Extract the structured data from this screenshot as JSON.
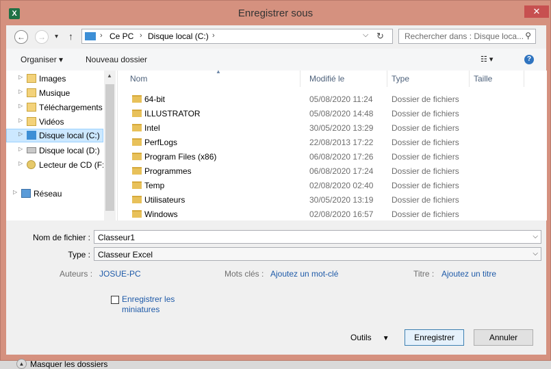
{
  "window": {
    "title": "Enregistrer sous",
    "app_icon_letter": "X",
    "close_glyph": "✕"
  },
  "nav": {
    "back_glyph": "←",
    "forward_glyph": "→",
    "recent_glyph": "▾",
    "up_glyph": "↑"
  },
  "address": {
    "crumbs": [
      "Ce PC",
      "Disque local (C:)"
    ],
    "separator": "›",
    "dropdown_glyph": "⌵",
    "refresh_glyph": "↻"
  },
  "search": {
    "placeholder": "Rechercher dans : Disque loca...",
    "icon_glyph": "⚲"
  },
  "toolbar": {
    "organize": "Organiser",
    "new_folder": "Nouveau dossier",
    "help_glyph": "?"
  },
  "sidebar": {
    "items": [
      {
        "label": "Images"
      },
      {
        "label": "Musique"
      },
      {
        "label": "Téléchargements"
      },
      {
        "label": "Vidéos"
      },
      {
        "label": "Disque local (C:)"
      },
      {
        "label": "Disque local (D:)"
      },
      {
        "label": "Lecteur de CD (F:"
      },
      {
        "label": "Réseau"
      }
    ]
  },
  "columns": {
    "name": "Nom",
    "modified": "Modifié le",
    "type": "Type",
    "size": "Taille"
  },
  "files": [
    {
      "name": "64-bit",
      "modified": "05/08/2020 11:24",
      "type": "Dossier de fichiers"
    },
    {
      "name": "ILLUSTRATOR",
      "modified": "05/08/2020 14:48",
      "type": "Dossier de fichiers"
    },
    {
      "name": "Intel",
      "modified": "30/05/2020 13:29",
      "type": "Dossier de fichiers"
    },
    {
      "name": "PerfLogs",
      "modified": "22/08/2013 17:22",
      "type": "Dossier de fichiers"
    },
    {
      "name": "Program Files (x86)",
      "modified": "06/08/2020 17:26",
      "type": "Dossier de fichiers"
    },
    {
      "name": "Programmes",
      "modified": "06/08/2020 17:24",
      "type": "Dossier de fichiers"
    },
    {
      "name": "Temp",
      "modified": "02/08/2020 02:40",
      "type": "Dossier de fichiers"
    },
    {
      "name": "Utilisateurs",
      "modified": "30/05/2020 13:19",
      "type": "Dossier de fichiers"
    },
    {
      "name": "Windows",
      "modified": "02/08/2020 16:57",
      "type": "Dossier de fichiers"
    }
  ],
  "form": {
    "filename_label": "Nom de fichier :",
    "filename_value": "Classeur1",
    "type_label": "Type :",
    "type_value": "Classeur Excel",
    "authors_label": "Auteurs :",
    "authors_value": "JOSUE-PC",
    "tags_label": "Mots clés :",
    "tags_value": "Ajoutez un mot-clé",
    "title_label": "Titre :",
    "title_value": "Ajoutez un titre",
    "thumbnails_line1": "Enregistrer les",
    "thumbnails_line2": "miniatures"
  },
  "footer": {
    "hide_folders": "Masquer les dossiers",
    "tools": "Outils",
    "save": "Enregistrer",
    "cancel": "Annuler"
  },
  "colors": {
    "title_bar": "#d5917f",
    "close": "#c75050",
    "link": "#1e5aa8",
    "selection": "#cce8ff",
    "folder": "#e8c15a"
  }
}
